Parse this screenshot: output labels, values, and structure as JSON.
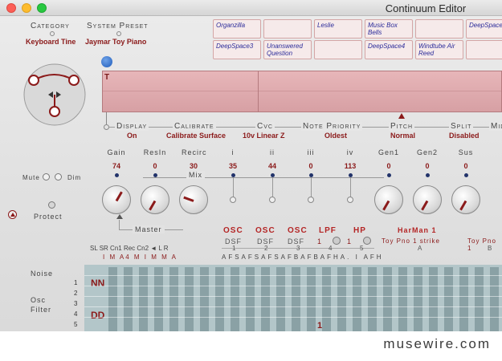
{
  "window": {
    "title": "Continuum Editor"
  },
  "header": {
    "category_label": "Category",
    "category_value": "Keyboard Tine",
    "preset_label": "System Preset",
    "preset_value": "Jaymar Toy Piano"
  },
  "preset_slots": {
    "row1": [
      "Organzilla",
      "",
      "Leslie",
      "Music Box Bells",
      "",
      "DeepSpace"
    ],
    "row2": [
      "DeepSpace3",
      "Unanswered Question",
      "",
      "DeepSpace4",
      "Windtube Air Reed",
      ""
    ]
  },
  "strip": {
    "marker": "T"
  },
  "settings": [
    {
      "label": "Display",
      "value": "On"
    },
    {
      "label": "Calibrate",
      "value": "Calibrate Surface"
    },
    {
      "label": "Cvc",
      "value": "10v Linear Z"
    },
    {
      "label": "Note Priority",
      "value": "Oldest"
    },
    {
      "label": "Pitch",
      "value": "Normal"
    },
    {
      "label": "Split",
      "value": "Disabled"
    },
    {
      "label": "Mid",
      "value": ""
    }
  ],
  "knobs": [
    {
      "label": "Gain",
      "value": "74"
    },
    {
      "label": "ResIn",
      "value": "0"
    },
    {
      "label": "Recirc",
      "value": "30"
    },
    {
      "label": "i",
      "value": "35"
    },
    {
      "label": "ii",
      "value": "44"
    },
    {
      "label": "iii",
      "value": "0"
    },
    {
      "label": "iv",
      "value": "113"
    },
    {
      "label": "Gen1",
      "value": "0"
    },
    {
      "label": "Gen2",
      "value": "0"
    },
    {
      "label": "Sus",
      "value": "0"
    }
  ],
  "controls": {
    "mute": "Mute",
    "dim": "Dim",
    "protect": "Protect",
    "mix": "Mix",
    "master": "Master"
  },
  "modules": {
    "osc1": "OSC",
    "osc2": "OSC",
    "osc3": "OSC",
    "lpf": "LPF",
    "hp": "HP",
    "harman": "HarMan 1",
    "dsf1": "DSF",
    "dsf2": "DSF",
    "dsf3": "DSF",
    "n1": "1",
    "n2": "2",
    "n3": "3",
    "n4": "4",
    "n5": "5",
    "n6": "1",
    "n7": "1",
    "toy1": "Toy Pno 1 strike",
    "toy2": "Toy Pno 1",
    "a_letter": "A",
    "b_letter": "B",
    "seq": "AFSAFSAFSAFBAFBAFHA.  I AFH"
  },
  "matrix": {
    "col_heads": "SL SR Cn1 Rec Cn2 ◄ L  R",
    "col_sub": "I M A4 M I M M A",
    "noise": "Noise",
    "osc_filter": "Osc Filter",
    "rows": [
      "1",
      "2",
      "3",
      "4",
      "5"
    ],
    "cell_nn": "NN",
    "cell_dd": "DD",
    "cell_one": "1"
  },
  "watermark": "musewire.com",
  "colors": {
    "accent": "#8b1a1a",
    "strip": "#d7a0a4",
    "grid": "#b3c6c9",
    "grid_dark": "#8aa1a5",
    "link": "#2c2c9a"
  }
}
